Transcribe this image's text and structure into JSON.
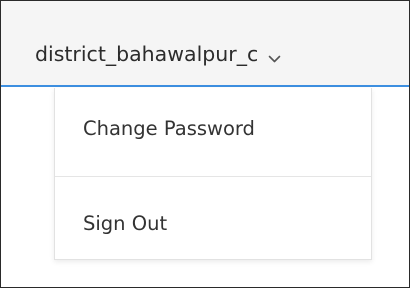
{
  "header": {
    "username": "district_bahawalpur_c",
    "dropdown_icon": "chevron-down-icon"
  },
  "user_menu": {
    "items": [
      {
        "label": "Change Password"
      },
      {
        "label": "Sign Out"
      }
    ]
  },
  "colors": {
    "topbar_background": "#f5f5f5",
    "accent_border": "#3d8fe0",
    "text": "#2c2c2c"
  }
}
